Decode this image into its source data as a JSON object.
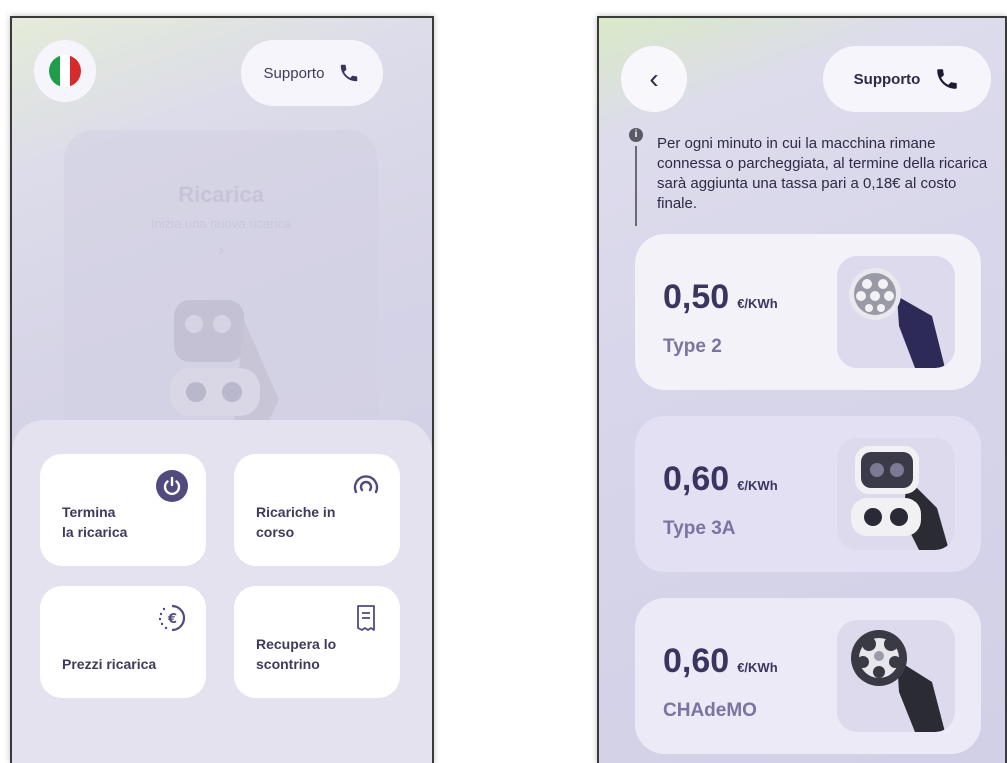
{
  "left_screen": {
    "support_label": "Supporto",
    "flag": {
      "colors": [
        "#1f9e4a",
        "#ffffff",
        "#d62b2b"
      ]
    },
    "ghost_card": {
      "title": "Ricarica",
      "subtitle": "Inizia una nuova ricarica"
    },
    "tiles": [
      {
        "label": "Termina\nla ricarica",
        "icon": "power-icon"
      },
      {
        "label": "Ricariche in\ncorso",
        "icon": "progress-ring-icon"
      },
      {
        "label": "Prezzi ricarica",
        "icon": "euro-icon"
      },
      {
        "label": "Recupera lo\nscontrino",
        "icon": "receipt-icon"
      }
    ]
  },
  "right_screen": {
    "support_label": "Supporto",
    "info_text": "Per ogni minuto in cui la macchina rimane connessa o parcheggiata, al termine della ricarica sarà aggiunta una tassa pari a 0,18€  al costo finale.",
    "prices": [
      {
        "value": "0,50",
        "unit": "€/KWh",
        "type": "Type 2"
      },
      {
        "value": "0,60",
        "unit": "€/KWh",
        "type": "Type 3A"
      },
      {
        "value": "0,60",
        "unit": "€/KWh",
        "type": "CHAdeMO"
      }
    ]
  },
  "colors": {
    "accent": "#514a7e",
    "tile_bg": "#ffffff",
    "text_dark": "#3f3a5c"
  }
}
